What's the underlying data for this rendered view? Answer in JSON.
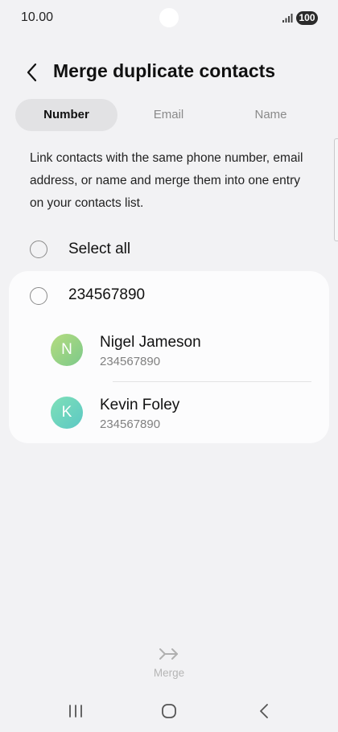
{
  "status_bar": {
    "time": "10.00",
    "battery": "100",
    "signal_icon": "signal-bars-icon"
  },
  "header": {
    "title": "Merge duplicate contacts",
    "back_icon": "chevron-left-icon"
  },
  "tabs": [
    {
      "label": "Number",
      "active": true
    },
    {
      "label": "Email",
      "active": false
    },
    {
      "label": "Name",
      "active": false
    }
  ],
  "description": "Link contacts with the same phone number, email address, or name and merge them into one entry on your contacts list.",
  "select_all": {
    "label": "Select all",
    "checked": false
  },
  "group": {
    "number": "234567890",
    "checked": false,
    "contacts": [
      {
        "initial": "N",
        "name": "Nigel Jameson",
        "phone": "234567890",
        "avatar_color": "#9ed383"
      },
      {
        "initial": "K",
        "name": "Kevin Foley",
        "phone": "234567890",
        "avatar_color": "#6fd4be"
      }
    ]
  },
  "footer": {
    "merge_label": "Merge",
    "merge_icon": "merge-arrow-icon",
    "enabled": false
  },
  "nav_bar": {
    "recents_icon": "recents-icon",
    "home_icon": "home-icon",
    "back_icon": "back-icon"
  },
  "colors": {
    "background": "#f2f2f4",
    "card": "#fcfcfd",
    "active_tab": "#e2e2e4",
    "disabled_text": "#b5b5b5"
  }
}
